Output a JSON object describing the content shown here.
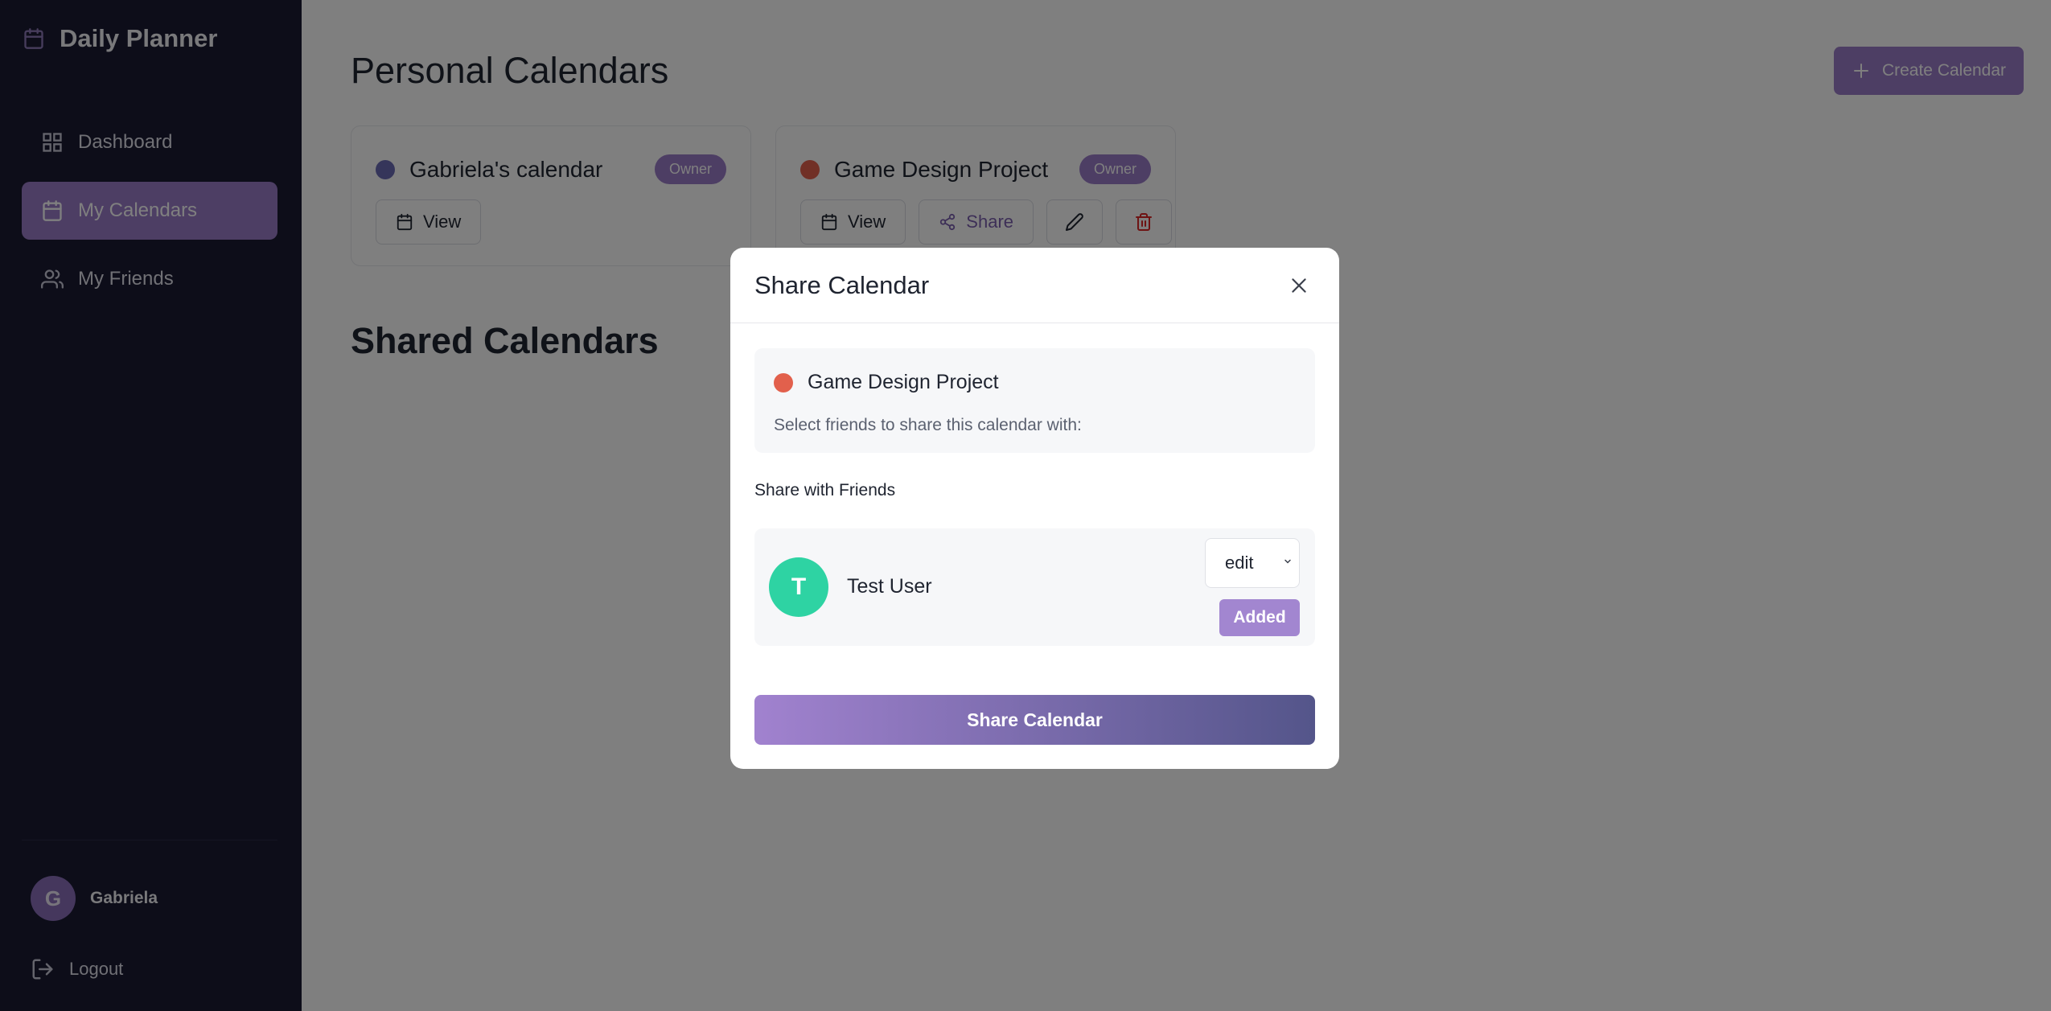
{
  "app": {
    "title": "Daily Planner"
  },
  "sidebar": {
    "items": [
      {
        "label": "Dashboard",
        "icon": "grid-icon"
      },
      {
        "label": "My Calendars",
        "icon": "calendar-icon",
        "active": true
      },
      {
        "label": "My Friends",
        "icon": "users-icon"
      }
    ],
    "user": {
      "initial": "G",
      "name": "Gabriela"
    },
    "logout_label": "Logout"
  },
  "main": {
    "personal_title": "Personal Calendars",
    "create_label": "Create Calendar",
    "shared_title": "Shared Calendars",
    "calendars": [
      {
        "name": "Gabriela's calendar",
        "color": "#6b6bb5",
        "badge": "Owner",
        "view_label": "View"
      },
      {
        "name": "Game Design Project",
        "color": "#e2604c",
        "badge": "Owner",
        "view_label": "View",
        "share_label": "Share"
      }
    ]
  },
  "modal": {
    "title": "Share Calendar",
    "calendar_name": "Game Design Project",
    "calendar_color": "#e2604c",
    "instruction": "Select friends to share this calendar with:",
    "share_with_label": "Share with Friends",
    "friends": [
      {
        "initial": "T",
        "name": "Test User",
        "avatar_color": "#2ed3a3",
        "permission": "edit",
        "status": "Added"
      }
    ],
    "submit_label": "Share Calendar"
  },
  "colors": {
    "sidebar_bg": "#1a1a33",
    "accent": "#9b7cc9",
    "delete": "#dc2626"
  }
}
